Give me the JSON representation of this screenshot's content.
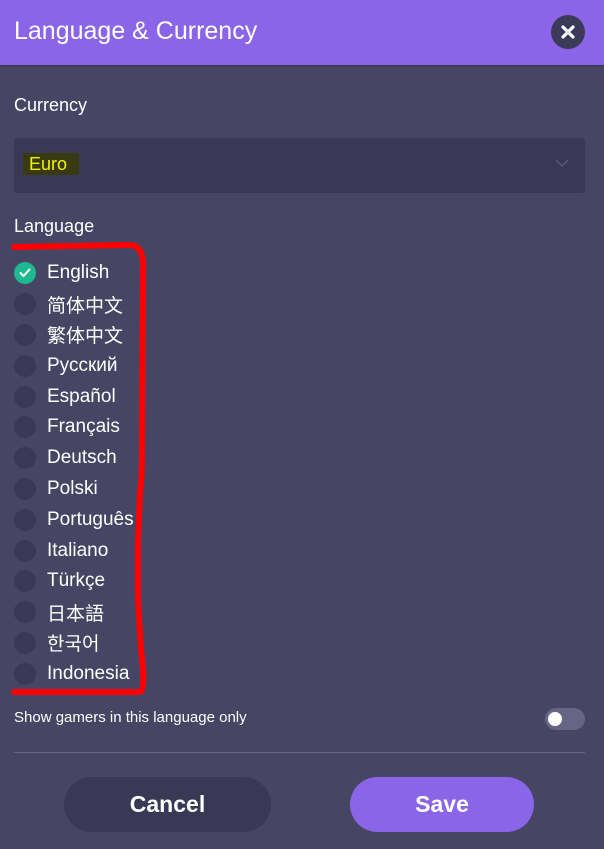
{
  "header": {
    "title": "Language & Currency",
    "close_icon": "close-icon"
  },
  "currency": {
    "label": "Currency",
    "selected": "Euro",
    "chevron_icon": "chevron-down-icon"
  },
  "language": {
    "label": "Language",
    "selected": "English",
    "items": [
      {
        "label": "English",
        "checked": true
      },
      {
        "label": "简体中文",
        "checked": false
      },
      {
        "label": "繁体中文",
        "checked": false
      },
      {
        "label": "Русский",
        "checked": false
      },
      {
        "label": "Español",
        "checked": false
      },
      {
        "label": "Français",
        "checked": false
      },
      {
        "label": "Deutsch",
        "checked": false
      },
      {
        "label": "Polski",
        "checked": false
      },
      {
        "label": "Português",
        "checked": false
      },
      {
        "label": "Italiano",
        "checked": false
      },
      {
        "label": "Türkçe",
        "checked": false
      },
      {
        "label": "日本語",
        "checked": false
      },
      {
        "label": "한국어",
        "checked": false
      },
      {
        "label": "Indonesia",
        "checked": false
      }
    ]
  },
  "filter": {
    "label": "Show gamers in this language only",
    "enabled": false
  },
  "footer": {
    "cancel_label": "Cancel",
    "save_label": "Save"
  },
  "colors": {
    "accent": "#8b65e8",
    "background": "#464564",
    "check": "#1fb890",
    "annotation": "#ff0000",
    "highlight_text": "#f2f200"
  }
}
